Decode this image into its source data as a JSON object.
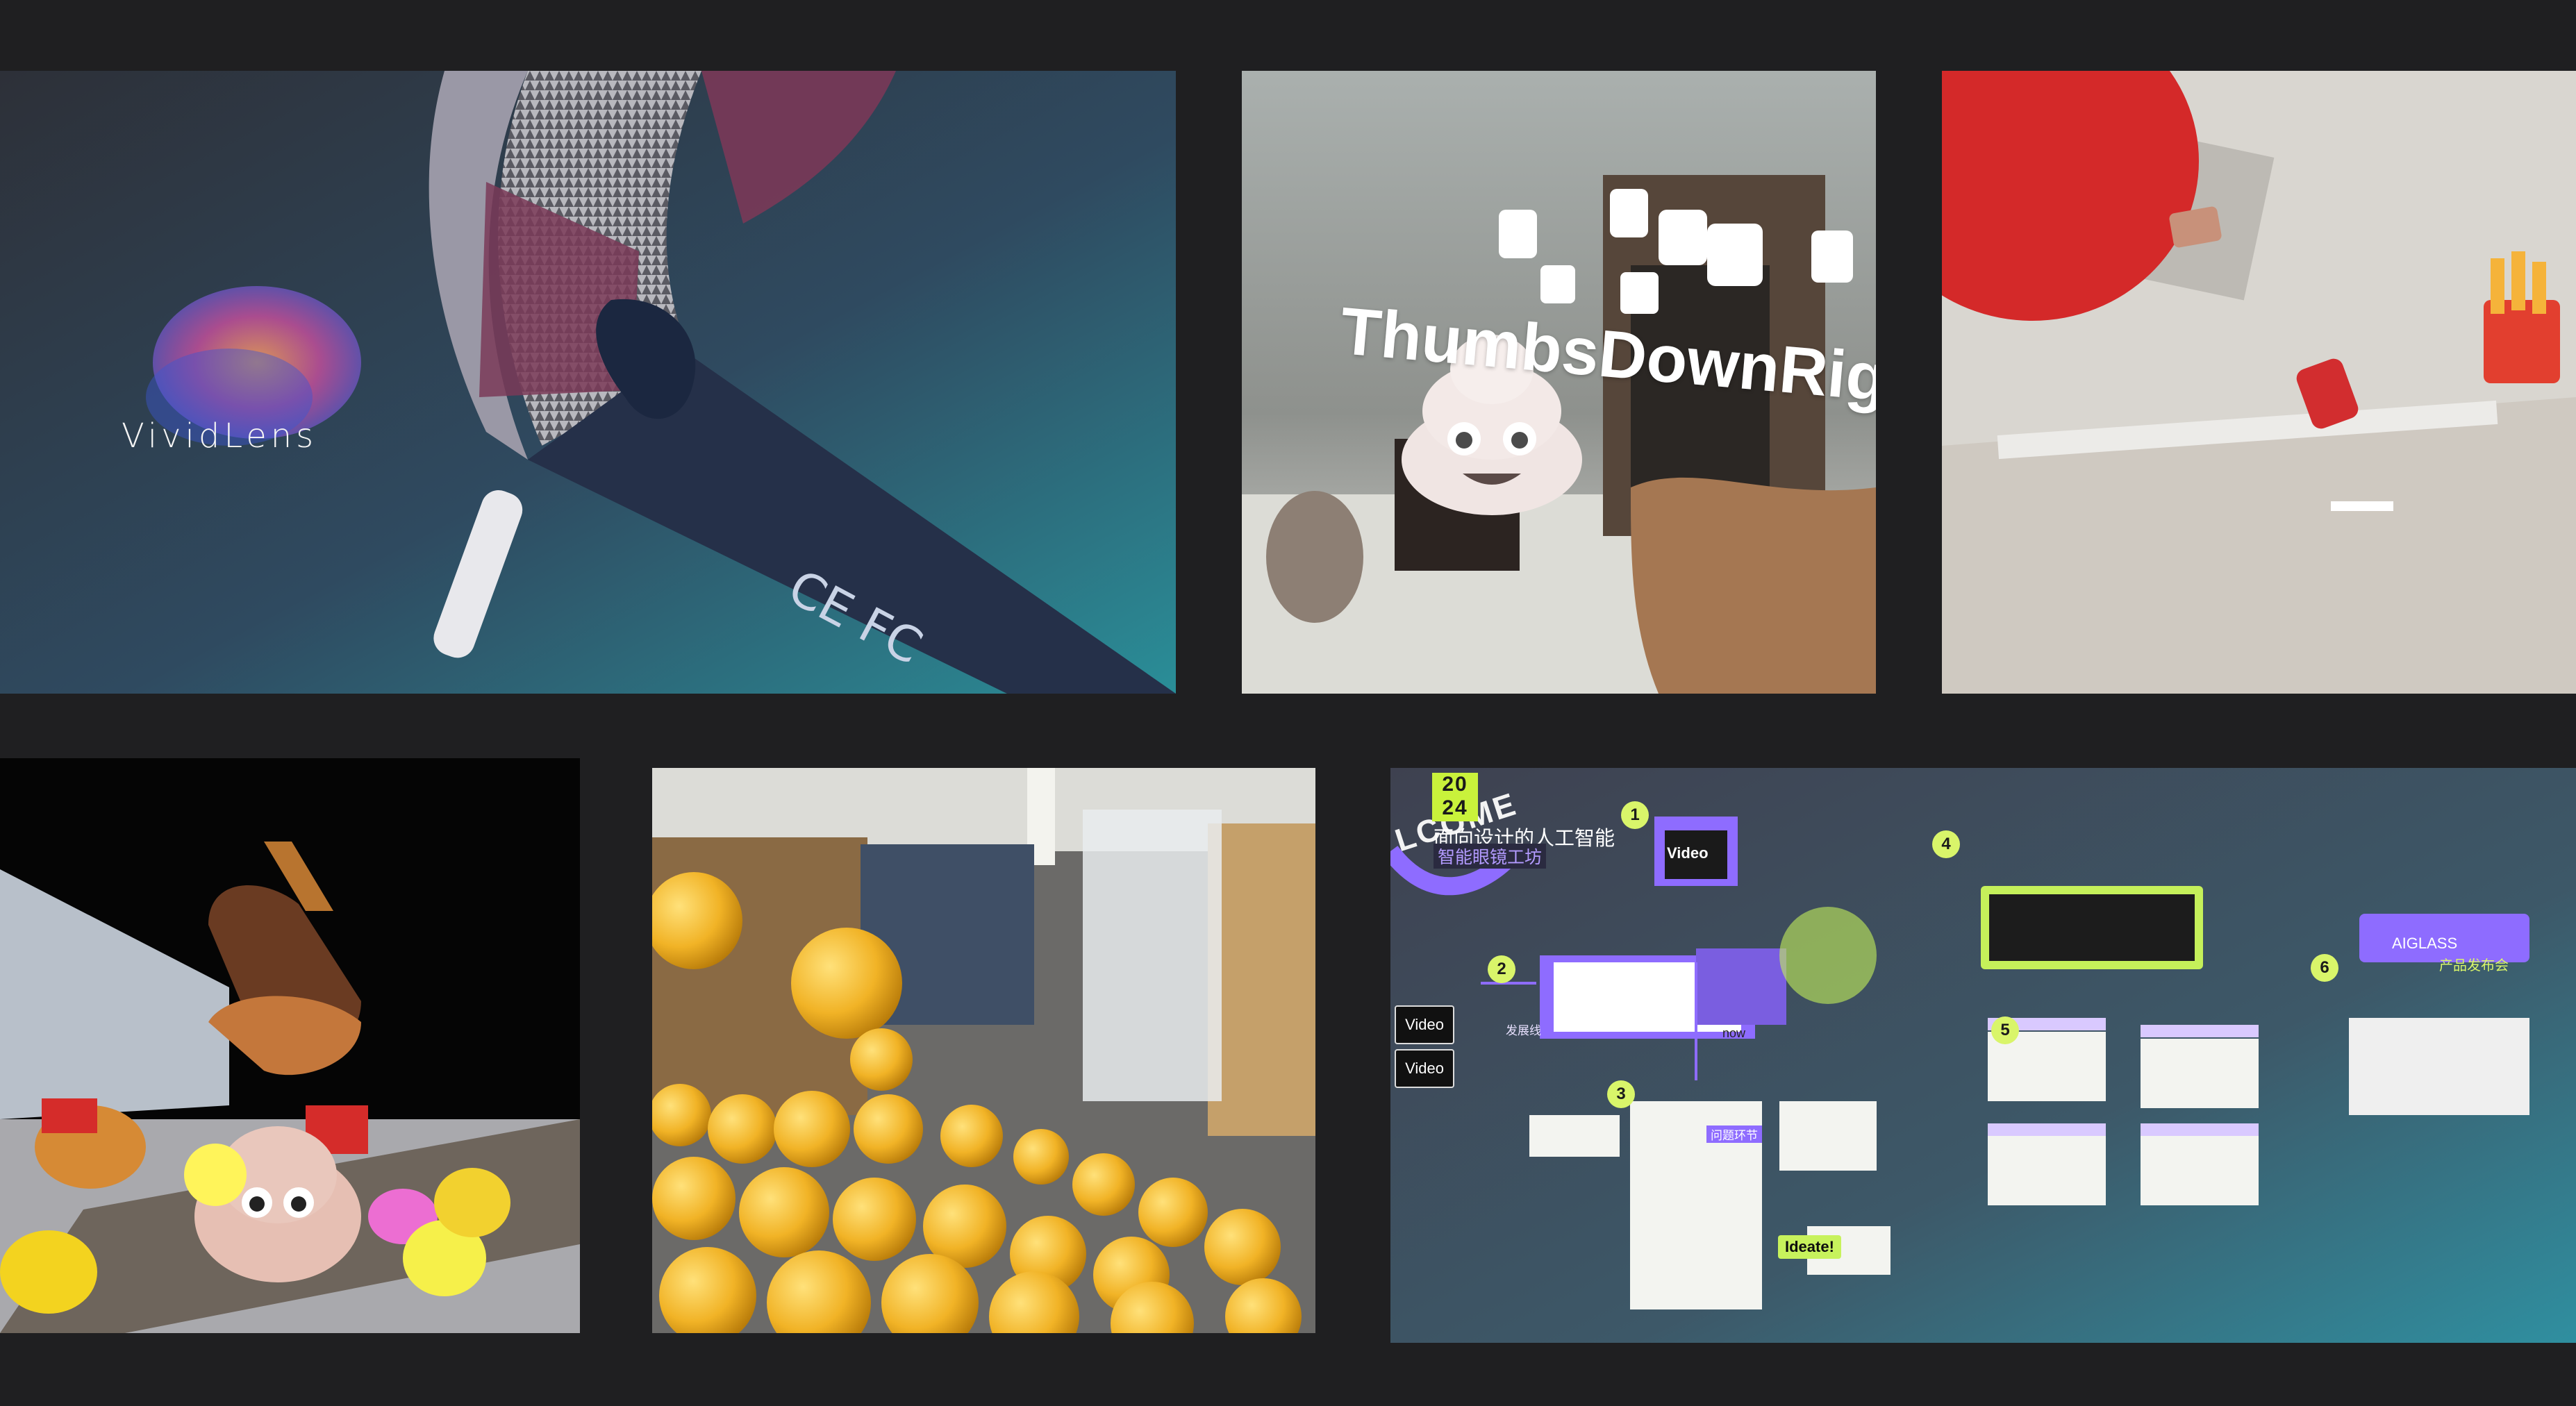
{
  "tiles": {
    "vividlens": {
      "brand": "VividLens"
    },
    "thumbs": {
      "title": "ThumbsDownRig"
    },
    "board": {
      "year_line1": "20",
      "year_line2": "24",
      "title": "面向设计的人工智能",
      "subtitle": "智能眼镜工坊",
      "welcome": "LCOME",
      "steps": [
        "1",
        "2",
        "3",
        "4",
        "5",
        "6"
      ],
      "video_buttons": [
        "Video",
        "Video"
      ],
      "video_card": "Video",
      "label_line": "发展线",
      "label_now": "now",
      "label_question": "问题环节",
      "ideate": "Ideate!",
      "product_title": "AIGLASS",
      "product_sub": "产品发布会"
    }
  },
  "colors": {
    "background": "#1f1f21",
    "accent_purple": "#8e6cff",
    "accent_lime": "#c9f23b"
  }
}
